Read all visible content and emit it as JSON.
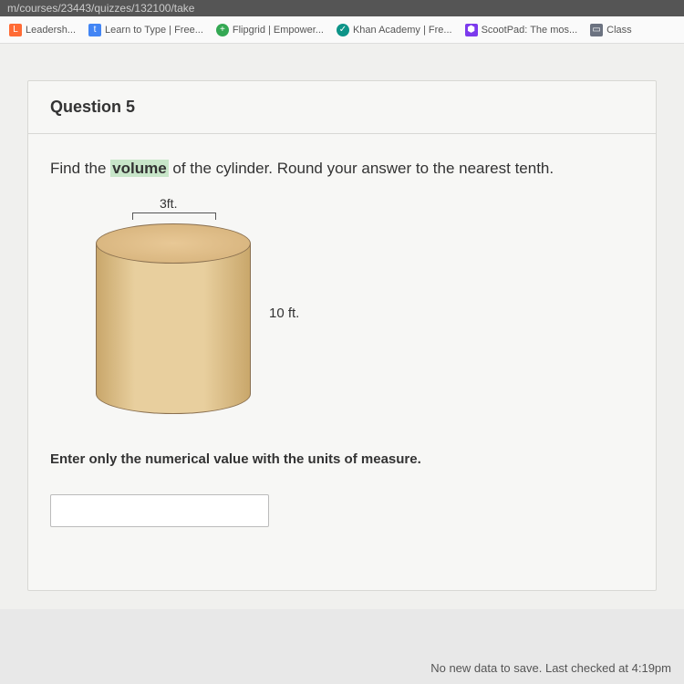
{
  "url": "m/courses/23443/quizzes/132100/take",
  "bookmarks": [
    {
      "label": "Leadersh...",
      "iconClass": "orange",
      "iconGlyph": "L"
    },
    {
      "label": "Learn to Type | Free...",
      "iconClass": "blue",
      "iconGlyph": "t"
    },
    {
      "label": "Flipgrid | Empower...",
      "iconClass": "green",
      "iconGlyph": "+"
    },
    {
      "label": "Khan Academy | Fre...",
      "iconClass": "teal",
      "iconGlyph": "✓"
    },
    {
      "label": "ScootPad: The mos...",
      "iconClass": "purple",
      "iconGlyph": "⬢"
    },
    {
      "label": "Class",
      "iconClass": "gray",
      "iconGlyph": "▭"
    }
  ],
  "question": {
    "header": "Question 5",
    "prompt_pre": "Find the ",
    "prompt_highlight": "volume",
    "prompt_post": " of the cylinder. Round your answer to the nearest tenth.",
    "radius_label": "3ft.",
    "height_label": "10 ft.",
    "instruction": "Enter only the numerical value with the units of measure.",
    "answer_value": ""
  },
  "status": "No new data to save. Last checked at 4:19pm"
}
